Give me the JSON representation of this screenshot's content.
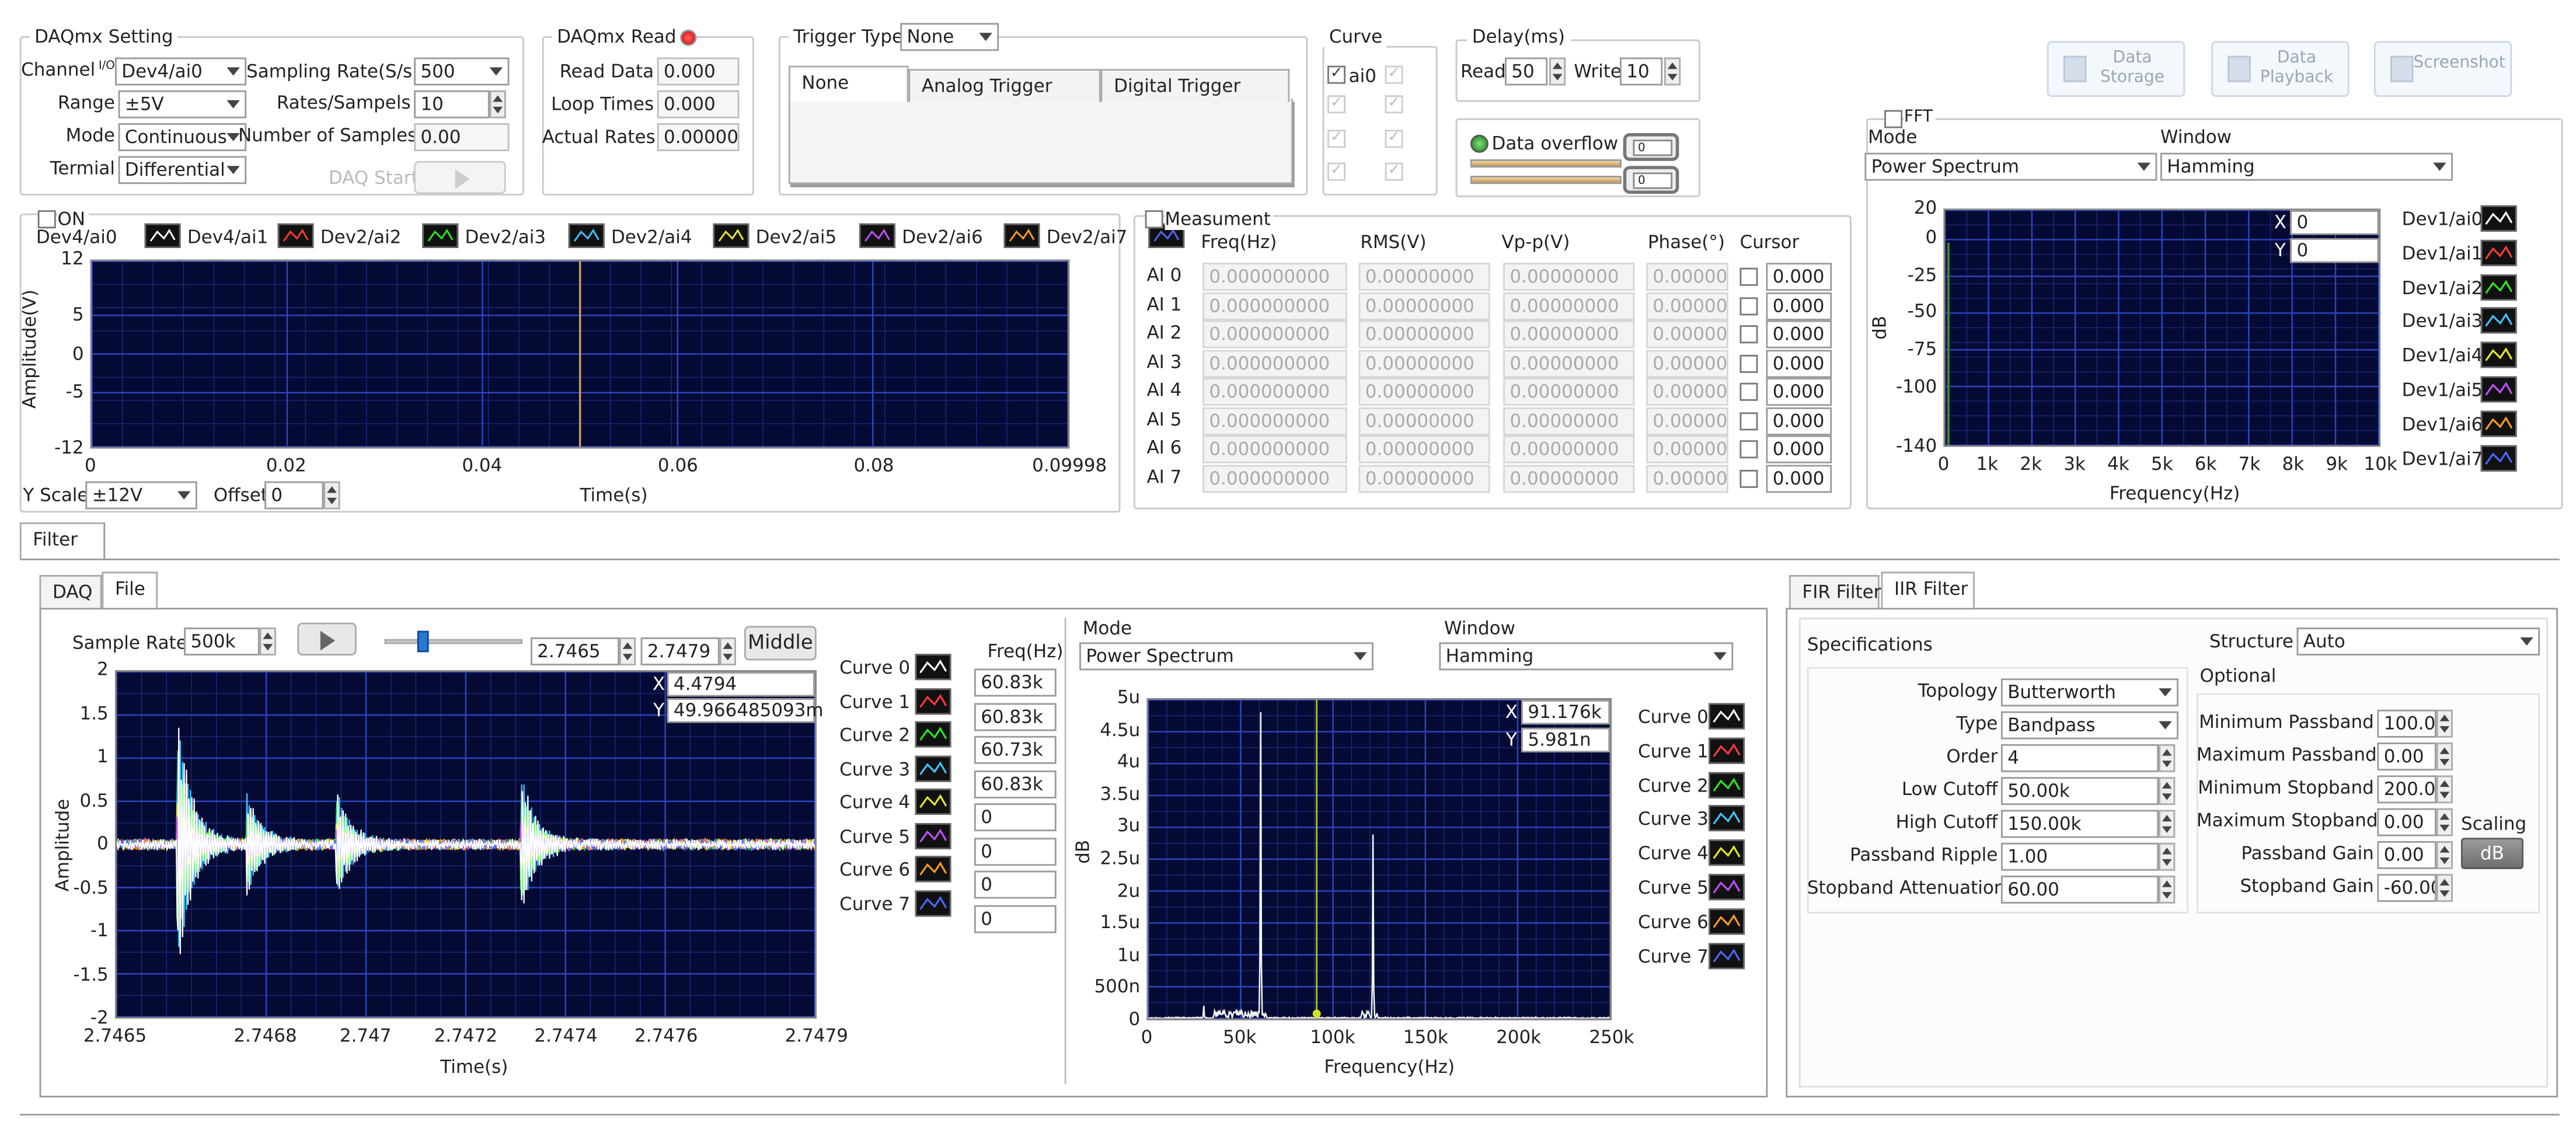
{
  "daqmx_setting": {
    "title": "DAQmx Setting",
    "channel_label": "Channel",
    "channel_glyph": "I/O",
    "channel_value": "Dev4/ai0",
    "range_label": "Range",
    "range_value": "±5V",
    "mode_label": "Mode",
    "mode_value": "Continuous",
    "terminal_label": "Termial",
    "terminal_value": "Differential",
    "sampling_rate_label": "Sampling Rate(S/s)",
    "sampling_rate_value": "500",
    "rates_label": "Rates/Sampels",
    "rates_value": "10",
    "num_samples_label": "Number of Samples",
    "num_samples_value": "0.00",
    "daq_start_label": "DAQ Start"
  },
  "daqmx_read": {
    "title": "DAQmx Read",
    "read_data_label": "Read Data",
    "read_data_value": "0.000",
    "loop_times_label": "Loop Times",
    "loop_times_value": "0.000",
    "actual_rates_label": "Actual Rates",
    "actual_rates_value": "0.00000"
  },
  "trigger": {
    "label": "Trigger Type",
    "value": "None",
    "tabs": [
      "None",
      "Analog Trigger",
      "Digital Trigger"
    ]
  },
  "curve": {
    "title": "Curve",
    "first_label": "ai0"
  },
  "delay": {
    "title": "Delay(ms)",
    "read_label": "Read",
    "read_value": "50",
    "write_label": "Write",
    "write_value": "10",
    "overflow_label": "Data overflow",
    "meter_value_1": "0",
    "meter_value_2": "0"
  },
  "top_buttons": [
    {
      "label_1": "Data",
      "label_2": "Storage"
    },
    {
      "label_1": "Data",
      "label_2": "Playback"
    },
    {
      "label_1": "Screenshot",
      "label_2": ""
    }
  ],
  "main_plot": {
    "on_label": "ON",
    "legend": [
      "Dev4/ai0",
      "Dev4/ai1",
      "Dev2/ai2",
      "Dev2/ai3",
      "Dev2/ai4",
      "Dev2/ai5",
      "Dev2/ai6",
      "Dev2/ai7"
    ],
    "legend_colors": [
      "#ffffff",
      "#ff3a3a",
      "#29e629",
      "#3ec4ff",
      "#e6e62a",
      "#c050ff",
      "#ff9a20",
      "#4a6aff"
    ],
    "ylabel": "Amplitude(V)",
    "xlabel": "Time(s)",
    "yscale_label": "Y Scale",
    "yscale_value": "±12V",
    "offset_label": "Offset",
    "offset_value": "0"
  },
  "measurement": {
    "title": "Measument",
    "headers": [
      "Freq(Hz)",
      "RMS(V)",
      "Vp-p(V)",
      "Phase(°)",
      "Cursor"
    ],
    "rows": [
      {
        "name": "AI 0",
        "freq": "0.000000000",
        "rms": "0.00000000",
        "vpp": "0.00000000",
        "phase": "0.00000",
        "cursor": "0.000"
      },
      {
        "name": "AI 1",
        "freq": "0.000000000",
        "rms": "0.00000000",
        "vpp": "0.00000000",
        "phase": "0.00000",
        "cursor": "0.000"
      },
      {
        "name": "AI 2",
        "freq": "0.000000000",
        "rms": "0.00000000",
        "vpp": "0.00000000",
        "phase": "0.00000",
        "cursor": "0.000"
      },
      {
        "name": "AI 3",
        "freq": "0.000000000",
        "rms": "0.00000000",
        "vpp": "0.00000000",
        "phase": "0.00000",
        "cursor": "0.000"
      },
      {
        "name": "AI 4",
        "freq": "0.000000000",
        "rms": "0.00000000",
        "vpp": "0.00000000",
        "phase": "0.00000",
        "cursor": "0.000"
      },
      {
        "name": "AI 5",
        "freq": "0.000000000",
        "rms": "0.00000000",
        "vpp": "0.00000000",
        "phase": "0.00000",
        "cursor": "0.000"
      },
      {
        "name": "AI 6",
        "freq": "0.000000000",
        "rms": "0.00000000",
        "vpp": "0.00000000",
        "phase": "0.00000",
        "cursor": "0.000"
      },
      {
        "name": "AI 7",
        "freq": "0.000000000",
        "rms": "0.00000000",
        "vpp": "0.00000000",
        "phase": "0.00000",
        "cursor": "0.000"
      }
    ]
  },
  "fft": {
    "title": "FFT",
    "mode_label": "Mode",
    "mode_value": "Power Spectrum",
    "window_label": "Window",
    "window_value": "Hamming",
    "ylabel": "dB",
    "xlabel": "Frequency(Hz)",
    "cursor_x_label": "X",
    "cursor_x": "0",
    "cursor_y_label": "Y",
    "cursor_y": "0",
    "legend": [
      "Dev1/ai0",
      "Dev1/ai1",
      "Dev1/ai2",
      "Dev1/ai3",
      "Dev1/ai4",
      "Dev1/ai5",
      "Dev1/ai6",
      "Dev1/ai7"
    ]
  },
  "filter": {
    "outer_tab": "Filter",
    "tabs": [
      "DAQ",
      "File"
    ],
    "sample_rates_label": "Sample Rates",
    "sample_rates_value": "500k",
    "range_start": "2.7465",
    "range_end": "2.7479",
    "middle_label": "Middle",
    "slider_position": 0.27,
    "time_plot": {
      "ylabel": "Amplitude",
      "xlabel": "Time(s)",
      "cursor_x_label": "X",
      "cursor_x": "4.4794",
      "cursor_y_label": "Y",
      "cursor_y": "49.966485093m"
    },
    "curves": [
      "Curve 0",
      "Curve 1",
      "Curve 2",
      "Curve 3",
      "Curve 4",
      "Curve 5",
      "Curve 6",
      "Curve 7"
    ],
    "freq_header": "Freq(Hz)",
    "freqs": [
      "60.83k",
      "60.83k",
      "60.73k",
      "60.83k",
      "0",
      "0",
      "0",
      "0"
    ],
    "spec": {
      "mode_label": "Mode",
      "mode_value": "Power Spectrum",
      "window_label": "Window",
      "window_value": "Hamming",
      "ylabel": "dB",
      "xlabel": "Frequency(Hz)",
      "cursor_x_label": "X",
      "cursor_x": "91.176k",
      "cursor_y_label": "Y",
      "cursor_y": "5.981n"
    }
  },
  "iir": {
    "tabs": [
      "FIR Filter",
      "IIR Filter"
    ],
    "specs_label": "Specifications",
    "structure_label": "Structure",
    "structure_value": "Auto",
    "optional_label": "Optional",
    "left": [
      {
        "label": "Topology",
        "value": "Butterworth",
        "dd": true
      },
      {
        "label": "Type",
        "value": "Bandpass",
        "dd": true
      },
      {
        "label": "Order",
        "value": "4"
      },
      {
        "label": "Low Cutoff",
        "value": "50.00k"
      },
      {
        "label": "High Cutoff",
        "value": "150.00k"
      },
      {
        "label": "Passband Ripple",
        "value": "1.00"
      },
      {
        "label": "Stopband Attenuation",
        "value": "60.00"
      }
    ],
    "right": [
      {
        "label": "Minimum Passband",
        "value": "100.00"
      },
      {
        "label": "Maximum Passband",
        "value": "0.00"
      },
      {
        "label": "Minimum Stopband",
        "value": "200.00"
      },
      {
        "label": "Maximum Stopband",
        "value": "0.00"
      },
      {
        "label": "Passband Gain",
        "value": "0.00"
      },
      {
        "label": "Stopband Gain",
        "value": "-60.00"
      }
    ],
    "scaling_label": "Scaling",
    "scaling_value": "dB"
  },
  "chart_data": [
    {
      "type": "line",
      "ylabel": "Amplitude(V)",
      "xlabel": "Time(s)",
      "ylim": [
        -12,
        12
      ],
      "xlim": [
        0,
        0.09998
      ],
      "yticks": [
        "12",
        "5",
        "0",
        "-5",
        "-12"
      ],
      "ytick_values": [
        12,
        5,
        0,
        -5,
        -12
      ],
      "xticks": [
        "0",
        "0.02",
        "0.04",
        "0.06",
        "0.08",
        "0.09998"
      ],
      "xtick_values": [
        0,
        0.02,
        0.04,
        0.06,
        0.08,
        0.09998
      ],
      "cursor_x": 0.05,
      "grid": true
    },
    {
      "type": "line",
      "ylabel": "dB",
      "xlabel": "Frequency(Hz)",
      "ylim": [
        -140,
        20
      ],
      "xlim": [
        0,
        10000
      ],
      "yticks": [
        "20",
        "0",
        "-25",
        "-50",
        "-75",
        "-100",
        "-140"
      ],
      "ytick_values": [
        20,
        0,
        -25,
        -50,
        -75,
        -100,
        -140
      ],
      "xticks": [
        "0",
        "1k",
        "2k",
        "3k",
        "4k",
        "5k",
        "6k",
        "7k",
        "8k",
        "9k",
        "10k"
      ],
      "xtick_values": [
        0,
        1000,
        2000,
        3000,
        4000,
        5000,
        6000,
        7000,
        8000,
        9000,
        10000
      ],
      "grid": true
    },
    {
      "type": "line",
      "ylabel": "Amplitude",
      "xlabel": "Time(s)",
      "ylim": [
        -2,
        2
      ],
      "xlim": [
        2.7465,
        2.7479
      ],
      "yticks": [
        "2",
        "1.5",
        "1",
        "0.5",
        "0",
        "-0.5",
        "-1",
        "-1.5",
        "-2"
      ],
      "ytick_values": [
        2,
        1.5,
        1,
        0.5,
        0,
        -0.5,
        -1,
        -1.5,
        -2
      ],
      "xticks": [
        "2.7465",
        "2.7468",
        "2.747",
        "2.7472",
        "2.7474",
        "2.7476",
        "2.7479"
      ],
      "xtick_values": [
        2.7465,
        2.7468,
        2.747,
        2.7472,
        2.7474,
        2.7476,
        2.7479
      ],
      "bursts": [
        {
          "t": 2.74662,
          "amp": 1.65
        },
        {
          "t": 2.74676,
          "amp": 0.6
        },
        {
          "t": 2.74694,
          "amp": 0.65
        },
        {
          "t": 2.74731,
          "amp": 0.85
        }
      ],
      "grid": true
    },
    {
      "type": "line",
      "ylabel": "dB",
      "xlabel": "Frequency(Hz)",
      "ylim": [
        0,
        5e-06
      ],
      "xlim": [
        0,
        250000
      ],
      "yticks": [
        "5u",
        "4.5u",
        "4u",
        "3.5u",
        "3u",
        "2.5u",
        "2u",
        "1.5u",
        "1u",
        "500n",
        "0"
      ],
      "ytick_values": [
        5e-06,
        4.5e-06,
        4e-06,
        3.5e-06,
        3e-06,
        2.5e-06,
        2e-06,
        1.5e-06,
        1e-06,
        5e-07,
        0
      ],
      "xticks": [
        "0",
        "50k",
        "100k",
        "150k",
        "200k",
        "250k"
      ],
      "xtick_values": [
        0,
        50000,
        100000,
        150000,
        200000,
        250000
      ],
      "peaks": [
        {
          "x": 60830,
          "y": 4.8e-06
        },
        {
          "x": 91176,
          "y": 5.98e-09
        },
        {
          "x": 121660,
          "y": 2.9e-06
        },
        {
          "x": 30000,
          "y": 2e-07
        }
      ],
      "cursor_x": 91176,
      "grid": true
    }
  ]
}
